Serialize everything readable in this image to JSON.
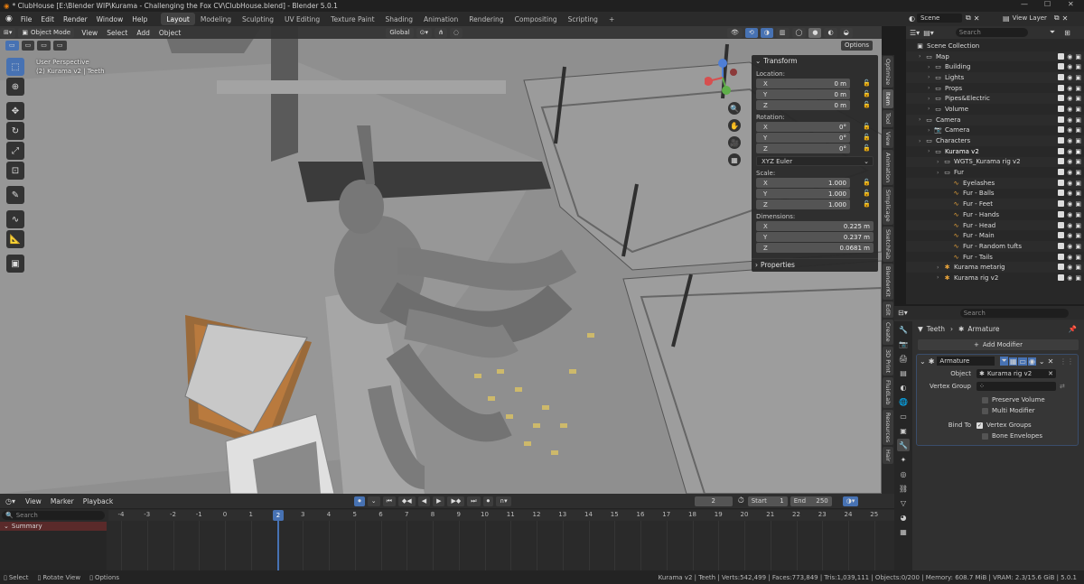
{
  "window": {
    "title": "* ClubHouse [E:\\Blender WIP\\Kurama - Challenging the Fox CV\\ClubHouse.blend] - Blender 5.0.1"
  },
  "topbar": {
    "menus": [
      "File",
      "Edit",
      "Render",
      "Window",
      "Help"
    ],
    "workspaces": [
      "Layout",
      "Modeling",
      "Sculpting",
      "UV Editing",
      "Texture Paint",
      "Shading",
      "Animation",
      "Rendering",
      "Compositing",
      "Scripting"
    ],
    "active_workspace": "Layout",
    "scene_name": "Scene",
    "view_layer": "View Layer"
  },
  "viewport": {
    "mode": "Object Mode",
    "menus": [
      "View",
      "Select",
      "Add",
      "Object"
    ],
    "orientation": "Global",
    "options_label": "Options",
    "info_line1": "User Perspective",
    "info_line2": "(2) Kurama v2 | Teeth"
  },
  "npanel": {
    "transform_title": "Transform",
    "location_label": "Location:",
    "location": [
      {
        "axis": "X",
        "value": "0 m"
      },
      {
        "axis": "Y",
        "value": "0 m"
      },
      {
        "axis": "Z",
        "value": "0 m"
      }
    ],
    "rotation_label": "Rotation:",
    "rotation": [
      {
        "axis": "X",
        "value": "0°"
      },
      {
        "axis": "Y",
        "value": "0°"
      },
      {
        "axis": "Z",
        "value": "0°"
      }
    ],
    "rotation_mode": "XYZ Euler",
    "scale_label": "Scale:",
    "scale": [
      {
        "axis": "X",
        "value": "1.000"
      },
      {
        "axis": "Y",
        "value": "1.000"
      },
      {
        "axis": "Z",
        "value": "1.000"
      }
    ],
    "dimensions_label": "Dimensions:",
    "dimensions": [
      {
        "axis": "X",
        "value": "0.225 m"
      },
      {
        "axis": "Y",
        "value": "0.237 m"
      },
      {
        "axis": "Z",
        "value": "0.0681 m"
      }
    ],
    "properties_title": "Properties"
  },
  "side_tabs": [
    "Optimize",
    "Item",
    "Tool",
    "View",
    "Animation",
    "Simplicage",
    "SketchFab",
    "BlenderKit",
    "Edit",
    "Create",
    "3D Print",
    "FluidLab",
    "Resources",
    "Hair"
  ],
  "active_side_tab": "Item",
  "outliner": {
    "search_placeholder": "Search",
    "rows": [
      {
        "label": "Scene Collection",
        "depth": 0,
        "icon": "scene-collection-icon"
      },
      {
        "label": "Map",
        "depth": 1,
        "icon": "collection-icon"
      },
      {
        "label": "Building",
        "depth": 2,
        "icon": "collection-icon"
      },
      {
        "label": "Lights",
        "depth": 2,
        "icon": "collection-icon"
      },
      {
        "label": "Props",
        "depth": 2,
        "icon": "collection-icon"
      },
      {
        "label": "Pipes&Electric",
        "depth": 2,
        "icon": "collection-icon"
      },
      {
        "label": "Volume",
        "depth": 2,
        "icon": "collection-icon"
      },
      {
        "label": "Camera",
        "depth": 1,
        "icon": "collection-icon"
      },
      {
        "label": "Camera",
        "depth": 2,
        "icon": "camera-icon"
      },
      {
        "label": "Characters",
        "depth": 1,
        "icon": "collection-icon"
      },
      {
        "label": "Kurama v2",
        "depth": 2,
        "icon": "collection-icon"
      },
      {
        "label": "WGTS_Kurama rig v2",
        "depth": 3,
        "icon": "collection-icon"
      },
      {
        "label": "Fur",
        "depth": 3,
        "icon": "collection-icon"
      },
      {
        "label": "Eyelashes",
        "depth": 4,
        "icon": "curves-icon"
      },
      {
        "label": "Fur - Balls",
        "depth": 4,
        "icon": "curves-icon"
      },
      {
        "label": "Fur - Feet",
        "depth": 4,
        "icon": "curves-icon"
      },
      {
        "label": "Fur - Hands",
        "depth": 4,
        "icon": "curves-icon"
      },
      {
        "label": "Fur - Head",
        "depth": 4,
        "icon": "curves-icon"
      },
      {
        "label": "Fur - Main",
        "depth": 4,
        "icon": "curves-icon"
      },
      {
        "label": "Fur - Random tufts",
        "depth": 4,
        "icon": "curves-icon"
      },
      {
        "label": "Fur - Tails",
        "depth": 4,
        "icon": "curves-icon"
      },
      {
        "label": "Kurama metarig",
        "depth": 3,
        "icon": "armature-icon"
      },
      {
        "label": "Kurama rig v2",
        "depth": 3,
        "icon": "armature-icon"
      }
    ]
  },
  "properties": {
    "search_placeholder": "Search",
    "breadcrumb_object": "Teeth",
    "breadcrumb_modifier": "Armature",
    "add_modifier_label": "Add Modifier",
    "modifier_name": "Armature",
    "object_label": "Object",
    "object_value": "Kurama rig v2",
    "vertex_group_label": "Vertex Group",
    "preserve_volume_label": "Preserve Volume",
    "multi_modifier_label": "Multi Modifier",
    "bind_to_label": "Bind To",
    "vertex_groups_label": "Vertex Groups",
    "bone_envelopes_label": "Bone Envelopes"
  },
  "timeline": {
    "menus": [
      "View",
      "Marker",
      "Playback"
    ],
    "current_frame": "2",
    "start_label": "Start",
    "start_value": "1",
    "end_label": "End",
    "end_value": "250",
    "search_placeholder": "Search",
    "summary_label": "Summary",
    "ticks": [
      "-4",
      "-3",
      "-2",
      "-1",
      "0",
      "1",
      "2",
      "3",
      "4",
      "5",
      "6",
      "7",
      "8",
      "9",
      "10",
      "11",
      "12",
      "13",
      "14",
      "15",
      "16",
      "17",
      "18",
      "19",
      "20",
      "21",
      "22",
      "23",
      "24",
      "25"
    ]
  },
  "statusbar": {
    "select": "Select",
    "rotate_view": "Rotate View",
    "options": "Options",
    "stats": "Kurama v2 | Teeth | Verts:542,499 | Faces:773,849 | Tris:1,039,111 | Objects:0/200 | Memory: 608.7 MiB | VRAM: 2.3/15.6 GiB | 5.0.1"
  },
  "colors": {
    "accent": "#4772b3",
    "active_element": "#e8a33a",
    "playhead": "#4772b3"
  }
}
